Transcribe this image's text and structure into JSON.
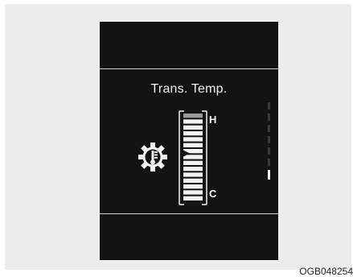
{
  "display": {
    "title": "Trans. Temp.",
    "high_label": "H",
    "low_label": "C",
    "temperature_level_fraction": 0.55,
    "segment_count": 15
  },
  "figure_code": "OGB048254",
  "colors": {
    "display_background": "#131313",
    "segment_lit": "#f2f2f2",
    "segment_top": "#9a9a9a",
    "frame_background": "#ececec"
  },
  "icons": [
    "transmission-temperature-icon"
  ]
}
